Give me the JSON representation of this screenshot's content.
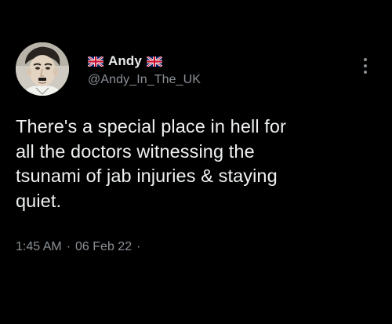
{
  "user": {
    "display_name": "Andy",
    "handle": "@Andy_In_The_UK",
    "flag_icon": "uk-flag-icon",
    "avatar_icon": "profile-avatar"
  },
  "tweet": {
    "text": "There's a special place in hell for\nall the doctors witnessing the\ntsunami of jab injuries & staying\nquiet.",
    "time": "1:45 AM",
    "separator": "·",
    "date": "06 Feb 22",
    "trailing_separator": "·"
  },
  "actions": {
    "more_icon": "more-vertical-icon"
  },
  "colors": {
    "background": "#000000",
    "primary_text": "#e7e9ea",
    "secondary_text": "#8b9096"
  }
}
